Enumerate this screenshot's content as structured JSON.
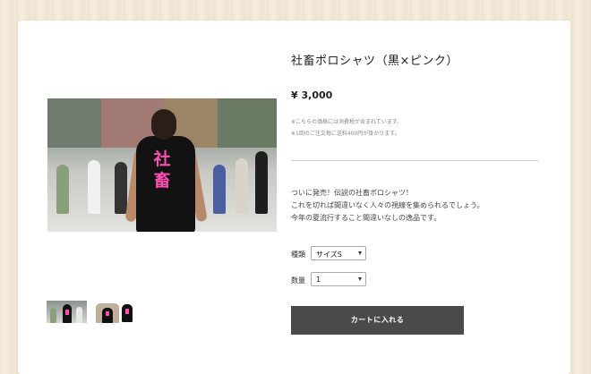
{
  "product": {
    "title": "社畜ポロシャツ（黒×ピンク）",
    "price": "¥ 3,000",
    "notes": [
      "※こちらの価格には消費税が含まれています。",
      "※1回のご注文毎に送料400円が掛かります。"
    ],
    "description": [
      "ついに発売！伝説の社畜ポロシャツ！",
      "これを切れば間違いなく人々の視線を集められるでしょう。",
      "今年の夏流行すること間違いなしの逸品です。"
    ],
    "photo_shirt_text": "社畜"
  },
  "options": {
    "type_label": "種類",
    "type_value": "サイズS",
    "qty_label": "数量",
    "qty_value": "1"
  },
  "cart_button": "カートに入れる",
  "colors": {
    "accent": "#ff4fb0",
    "button": "#4a4a4a"
  }
}
